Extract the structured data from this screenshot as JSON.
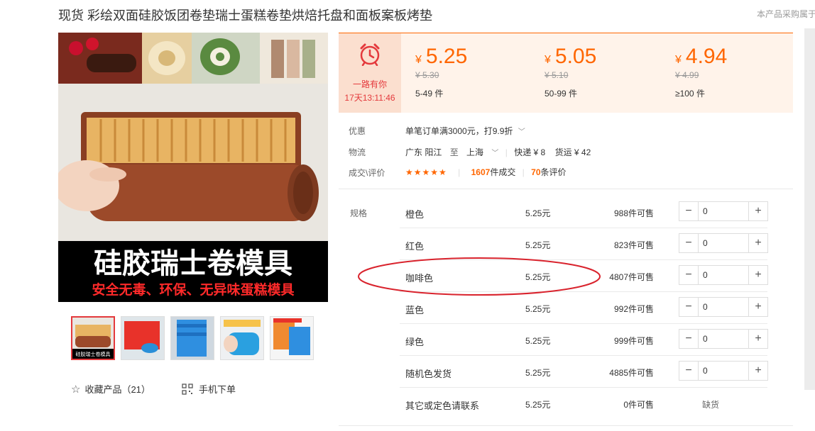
{
  "product": {
    "title": "现货 彩绘双面硅胶饭团卷垫瑞士蛋糕卷垫烘焙托盘和面板案板烤垫",
    "top_right_note": "本产品采购属于"
  },
  "main_image": {
    "headline": "硅胶瑞士卷模具",
    "subline": "安全无毒、环保、无异味蛋糕模具"
  },
  "thumbnails": {
    "first_caption": "硅胶瑞士卷模具"
  },
  "actions": {
    "collect_label": "收藏产品（21）",
    "mobile_label": "手机下单"
  },
  "promotion": {
    "name": "一路有你",
    "countdown": "17天13:11:46",
    "icon": "alarm-clock-icon"
  },
  "price_tiers": [
    {
      "currency": "¥",
      "price": "5.25",
      "original": "¥ 5.30",
      "range": "5-49  件"
    },
    {
      "currency": "¥",
      "price": "5.05",
      "original": "¥ 5.10",
      "range": "50-99  件"
    },
    {
      "currency": "¥",
      "price": "4.94",
      "original": "¥ 4.99",
      "range": "≥100  件"
    }
  ],
  "info": {
    "discount_label": "优惠",
    "discount_value": "单笔订单满3000元，打9.9折",
    "logistics_label": "物流",
    "origin": "广东 阳江",
    "to": "至",
    "destination": "上海",
    "express": "快递 ¥ 8",
    "freight": "货运 ¥ 42",
    "deal_label": "成交\\评价",
    "stars": "★★★★★",
    "deals_count": "1607",
    "deals_suffix": "件成交",
    "reviews_count": "70",
    "reviews_suffix": "条评价"
  },
  "spec": {
    "label": "规格",
    "rows": [
      {
        "name": "橙色",
        "price": "5.25元",
        "stock": "988件可售",
        "qty": "0"
      },
      {
        "name": "红色",
        "price": "5.25元",
        "stock": "823件可售",
        "qty": "0"
      },
      {
        "name": "咖啡色",
        "price": "5.25元",
        "stock": "4807件可售",
        "qty": "0"
      },
      {
        "name": "蓝色",
        "price": "5.25元",
        "stock": "992件可售",
        "qty": "0"
      },
      {
        "name": "绿色",
        "price": "5.25元",
        "stock": "999件可售",
        "qty": "0"
      },
      {
        "name": "随机色发货",
        "price": "5.25元",
        "stock": "4885件可售",
        "qty": "0"
      },
      {
        "name": "其它或定色请联系",
        "price": "5.25元",
        "stock": "0件可售",
        "status": "缺货"
      }
    ]
  },
  "colors": {
    "accent": "#ff6600",
    "promo_red": "#e4393c",
    "annotation": "#d9232d"
  }
}
